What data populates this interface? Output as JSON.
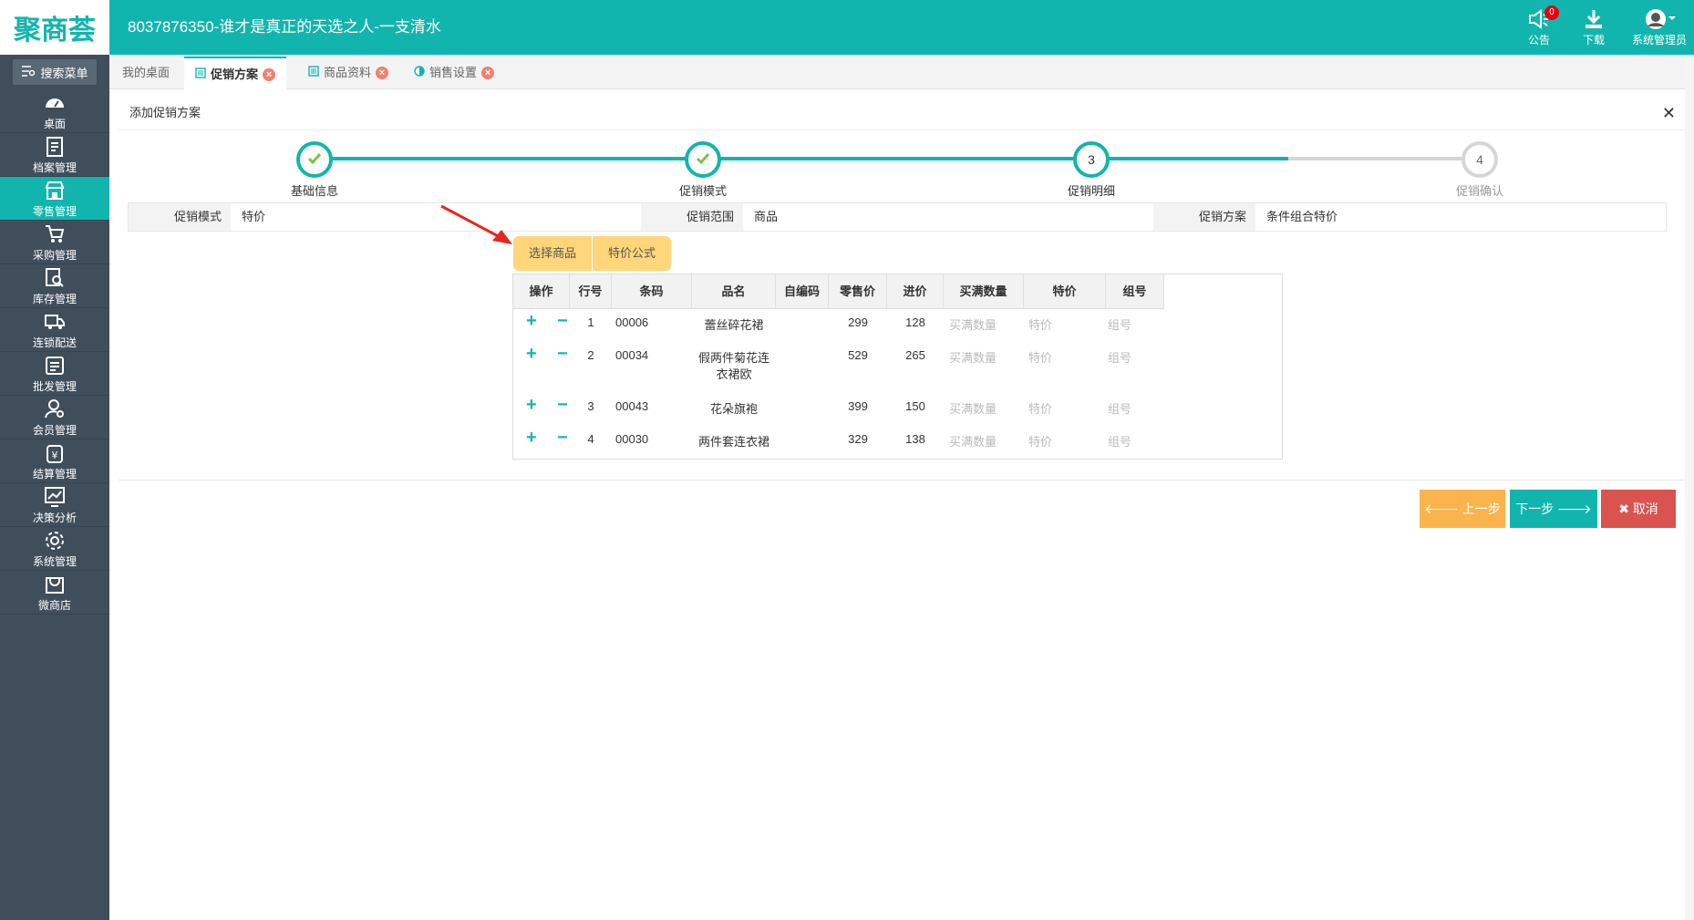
{
  "header": {
    "logo": "聚商荟",
    "title": "8037876350-谁才是真正的天选之人-一支清水",
    "announce_label": "公告",
    "announce_count": "0",
    "download_label": "下载",
    "user_label": "系统管理员"
  },
  "sidebar": {
    "search_label": "搜索菜单",
    "items": [
      {
        "label": "桌面",
        "icon": "dashboard-icon"
      },
      {
        "label": "档案管理",
        "icon": "archive-icon"
      },
      {
        "label": "零售管理",
        "icon": "store-icon"
      },
      {
        "label": "采购管理",
        "icon": "cart-icon"
      },
      {
        "label": "库存管理",
        "icon": "inventory-search-icon"
      },
      {
        "label": "连锁配送",
        "icon": "truck-icon"
      },
      {
        "label": "批发管理",
        "icon": "wholesale-icon"
      },
      {
        "label": "会员管理",
        "icon": "member-icon"
      },
      {
        "label": "结算管理",
        "icon": "yuan-icon"
      },
      {
        "label": "决策分析",
        "icon": "chart-icon"
      },
      {
        "label": "系统管理",
        "icon": "gear-icon"
      },
      {
        "label": "微商店",
        "icon": "shop-bag-icon"
      }
    ]
  },
  "tabs": [
    {
      "label": "我的桌面"
    },
    {
      "label": "促销方案"
    },
    {
      "label": "商品资料"
    },
    {
      "label": "销售设置"
    }
  ],
  "panel": {
    "title": "添加促销方案"
  },
  "steps": [
    {
      "label": "基础信息",
      "number": "1",
      "state": "done"
    },
    {
      "label": "促销模式",
      "number": "2",
      "state": "done"
    },
    {
      "label": "促销明细",
      "number": "3",
      "state": "current"
    },
    {
      "label": "促销确认",
      "number": "4",
      "state": "pending"
    }
  ],
  "info": {
    "mode_key": "促销模式",
    "mode_value": "特价",
    "scope_key": "促销范围",
    "scope_value": "商品",
    "plan_key": "促销方案",
    "plan_value": "条件组合特价"
  },
  "actions": {
    "select_goods": "选择商品",
    "formula": "特价公式"
  },
  "table": {
    "columns": [
      "操作",
      "行号",
      "条码",
      "品名",
      "自编码",
      "零售价",
      "进价",
      "买满数量",
      "特价",
      "组号"
    ],
    "rows": [
      {
        "no": "1",
        "barcode": "00006",
        "name": "蕾丝碎花裙",
        "name2": "",
        "code": "",
        "retail": "299",
        "cost": "128",
        "qty_ph": "买满数量",
        "price_ph": "特价",
        "group_ph": "组号"
      },
      {
        "no": "2",
        "barcode": "00034",
        "name": "假两件菊花连",
        "name2": "衣裙欧",
        "code": "",
        "retail": "529",
        "cost": "265",
        "qty_ph": "买满数量",
        "price_ph": "特价",
        "group_ph": "组号"
      },
      {
        "no": "3",
        "barcode": "00043",
        "name": "花朵旗袍",
        "name2": "",
        "code": "",
        "retail": "399",
        "cost": "150",
        "qty_ph": "买满数量",
        "price_ph": "特价",
        "group_ph": "组号"
      },
      {
        "no": "4",
        "barcode": "00030",
        "name": "两件套连衣裙",
        "name2": "",
        "code": "",
        "retail": "329",
        "cost": "138",
        "qty_ph": "买满数量",
        "price_ph": "特价",
        "group_ph": "组号"
      }
    ]
  },
  "buttons": {
    "prev": "上一步",
    "next": "下一步",
    "cancel": "取消"
  },
  "colors": {
    "brand": "#12b5ad",
    "sidebar": "#404e5c",
    "prev": "#f9b44d",
    "cancel": "#d9534f",
    "arrow": "#e6261f"
  }
}
